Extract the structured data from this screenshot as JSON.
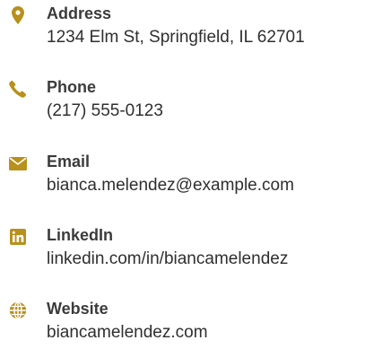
{
  "accent_color": "#b8901c",
  "contacts": [
    {
      "icon": "map-marker-icon",
      "label": "Address",
      "value": "1234 Elm St, Springfield, IL 62701"
    },
    {
      "icon": "phone-icon",
      "label": "Phone",
      "value": "(217) 555-0123"
    },
    {
      "icon": "envelope-icon",
      "label": "Email",
      "value": "bianca.melendez@example.com"
    },
    {
      "icon": "linkedin-icon",
      "label": "LinkedIn",
      "value": "linkedin.com/in/biancamelendez"
    },
    {
      "icon": "globe-icon",
      "label": "Website",
      "value": "biancamelendez.com"
    }
  ]
}
